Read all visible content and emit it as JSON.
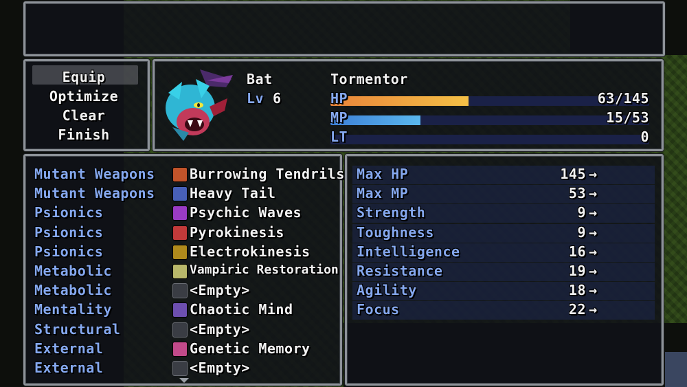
{
  "commands": [
    "Equip",
    "Optimize",
    "Clear",
    "Finish"
  ],
  "actor": {
    "name": "Bat",
    "class": "Tormentor",
    "level_label": "Lv",
    "level": "6",
    "hp_label": "HP",
    "hp_value": "63/145",
    "hp_fill": 0.434,
    "mp_label": "MP",
    "mp_value": "15/53",
    "mp_fill": 0.283,
    "lt_label": "LT",
    "lt_value": "0",
    "lt_fill": 0
  },
  "colors": {
    "hp_bar_start": "#e9843a",
    "hp_bar_end": "#f4c046",
    "mp_bar_start": "#3d7fd6",
    "mp_bar_end": "#5ab8ee"
  },
  "slots": [
    {
      "type": "Mutant Weapons",
      "item": "Burrowing Tendrils",
      "icon": "claw-strike-icon",
      "icon_color": "#c2542a"
    },
    {
      "type": "Mutant Weapons",
      "item": "Heavy Tail",
      "icon": "tail-icon",
      "icon_color": "#4860b8"
    },
    {
      "type": "Psionics",
      "item": "Psychic Waves",
      "icon": "psychic-wave-icon",
      "icon_color": "#9a3bc4"
    },
    {
      "type": "Psionics",
      "item": "Pyrokinesis",
      "icon": "fire-icon",
      "icon_color": "#c23a3a"
    },
    {
      "type": "Psionics",
      "item": "Electrokinesis",
      "icon": "lightning-icon",
      "icon_color": "#b08a1c"
    },
    {
      "type": "Metabolic",
      "item": "Vampiric Restoration",
      "icon": "blood-cells-icon",
      "icon_color": "#b9b86a"
    },
    {
      "type": "Metabolic",
      "item": "<Empty>",
      "icon": "empty-slot-icon",
      "icon_color": ""
    },
    {
      "type": "Mentality",
      "item": "Chaotic Mind",
      "icon": "spiral-icon",
      "icon_color": "#6d4fb0"
    },
    {
      "type": "Structural",
      "item": "<Empty>",
      "icon": "empty-slot-icon",
      "icon_color": ""
    },
    {
      "type": "External",
      "item": "Genetic Memory",
      "icon": "dna-icon",
      "icon_color": "#c24a8a"
    },
    {
      "type": "External",
      "item": "<Empty>",
      "icon": "empty-slot-icon",
      "icon_color": ""
    }
  ],
  "stats": [
    {
      "label": "Max HP",
      "value": "145",
      "arrow": "→"
    },
    {
      "label": "Max MP",
      "value": "53",
      "arrow": "→"
    },
    {
      "label": "Strength",
      "value": "9",
      "arrow": "→"
    },
    {
      "label": "Toughness",
      "value": "9",
      "arrow": "→"
    },
    {
      "label": "Intelligence",
      "value": "16",
      "arrow": "→"
    },
    {
      "label": "Resistance",
      "value": "19",
      "arrow": "→"
    },
    {
      "label": "Agility",
      "value": "18",
      "arrow": "→"
    },
    {
      "label": "Focus",
      "value": "22",
      "arrow": "→"
    }
  ]
}
